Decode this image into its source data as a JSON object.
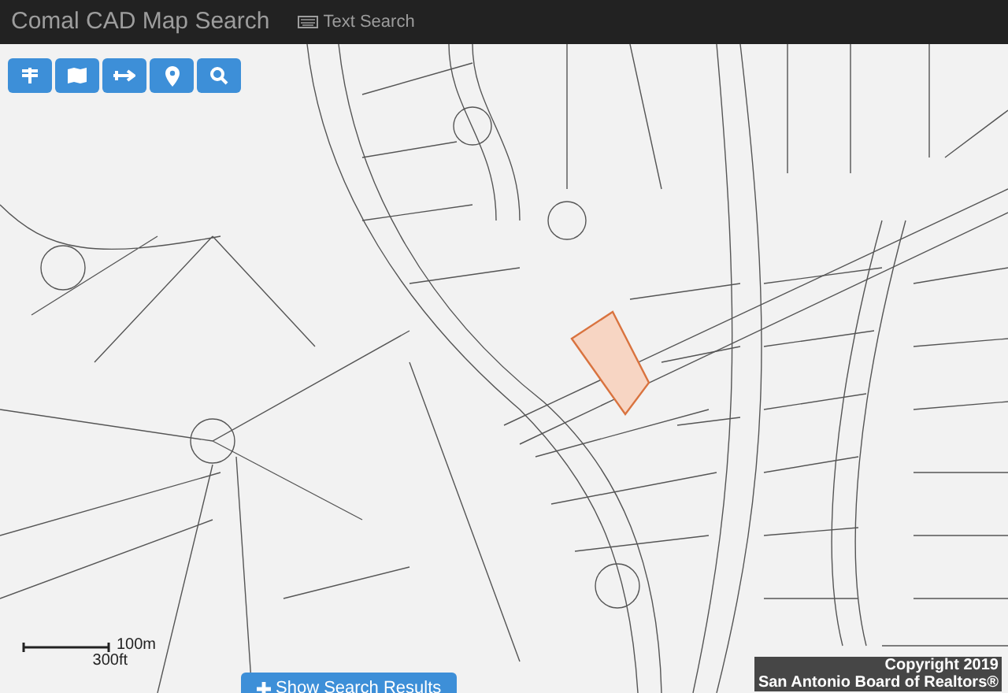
{
  "navbar": {
    "brand": "Comal CAD Map Search",
    "links": [
      {
        "label": "Text Search"
      }
    ]
  },
  "scale_bar": {
    "metric": "100m",
    "imperial": "300ft"
  },
  "attribution": [
    "Copyright 2019",
    "San Antonio Board of Realtors®"
  ],
  "show_results_button": {
    "label": "Show Search Results"
  }
}
